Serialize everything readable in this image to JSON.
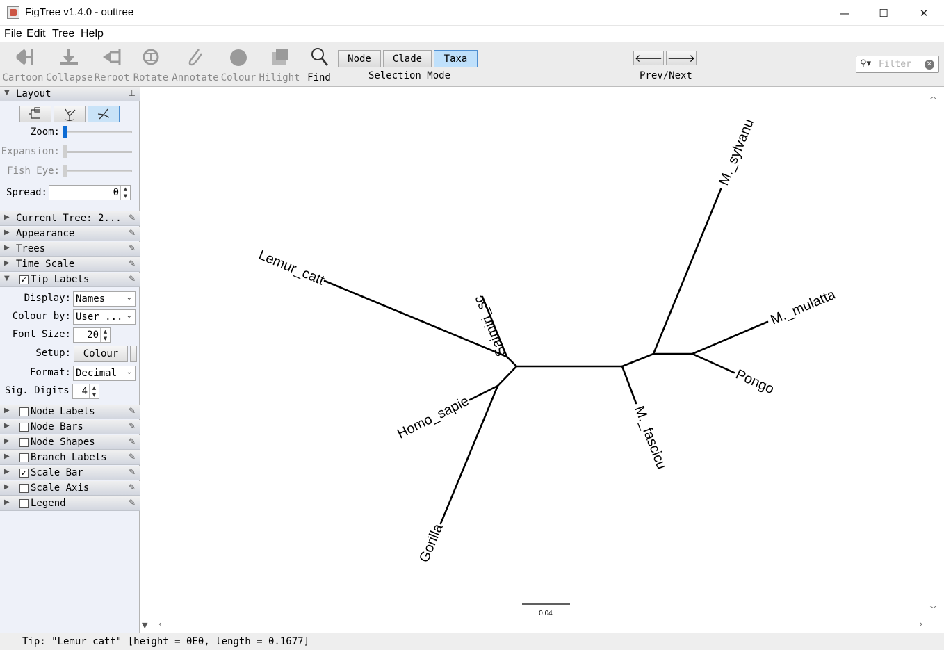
{
  "window": {
    "title": "FigTree v1.4.0 - outtree",
    "minimize": "—",
    "maximize": "☐",
    "close": "✕"
  },
  "menu": [
    "File",
    "Edit",
    "Tree",
    "Help"
  ],
  "toolbar": {
    "tools": [
      {
        "label": "Cartoon",
        "icon": "cartoon-icon",
        "enabled": false
      },
      {
        "label": "Collapse",
        "icon": "collapse-icon",
        "enabled": false
      },
      {
        "label": "Reroot",
        "icon": "reroot-icon",
        "enabled": false
      },
      {
        "label": "Rotate",
        "icon": "rotate-icon",
        "enabled": false
      },
      {
        "label": "Annotate",
        "icon": "annotate-icon",
        "enabled": false
      },
      {
        "label": "Colour",
        "icon": "colour-icon",
        "enabled": false
      },
      {
        "label": "Hilight",
        "icon": "hilight-icon",
        "enabled": false
      },
      {
        "label": "Find",
        "icon": "find-icon",
        "enabled": true
      }
    ],
    "selection_mode": {
      "buttons": [
        "Node",
        "Clade",
        "Taxa"
      ],
      "active": "Taxa",
      "caption": "Selection Mode"
    },
    "prev_next": {
      "prev": "🡐",
      "next": "🡒",
      "caption": "Prev/Next"
    },
    "filter": {
      "placeholder": "Filter"
    }
  },
  "panel": {
    "layout": {
      "title": "Layout",
      "active_layout": "radial",
      "zoom_label": "Zoom:",
      "expansion_label": "Expansion:",
      "fisheye_label": "Fish Eye:",
      "spread_label": "Spread:",
      "spread_value": "0"
    },
    "sections_top": [
      {
        "label": "Current Tree: 2...",
        "checkbox": null
      },
      {
        "label": "Appearance",
        "checkbox": null
      },
      {
        "label": "Trees",
        "checkbox": null
      },
      {
        "label": "Time Scale",
        "checkbox": null
      }
    ],
    "tip_labels": {
      "label": "Tip Labels",
      "checked": true,
      "display_label": "Display:",
      "display_value": "Names",
      "colour_by_label": "Colour by:",
      "colour_by_value": "User ...",
      "font_size_label": "Font Size:",
      "font_size_value": "20",
      "setup_label": "Setup:",
      "setup_button": "Colour",
      "format_label": "Format:",
      "format_value": "Decimal",
      "sig_digits_label": "Sig. Digits:",
      "sig_digits_value": "4"
    },
    "sections_bottom": [
      {
        "label": "Node Labels",
        "checked": false
      },
      {
        "label": "Node Bars",
        "checked": false
      },
      {
        "label": "Node Shapes",
        "checked": false
      },
      {
        "label": "Branch Labels",
        "checked": false
      },
      {
        "label": "Scale Bar",
        "checked": true
      },
      {
        "label": "Scale Axis",
        "checked": false
      },
      {
        "label": "Legend",
        "checked": false
      }
    ]
  },
  "tree": {
    "taxa": [
      "M._sylvanu",
      "Saimiri_sc",
      "Lemur_catt",
      "M._mulatta",
      "Pongo",
      "M._fascicu",
      "Homo_sapie",
      "Gorilla"
    ],
    "scale_bar_label": "0.04",
    "line_color": "#000000"
  },
  "status": {
    "text": "Tip: \"Lemur_catt\" [height = 0E0, length = 0.1677]"
  }
}
